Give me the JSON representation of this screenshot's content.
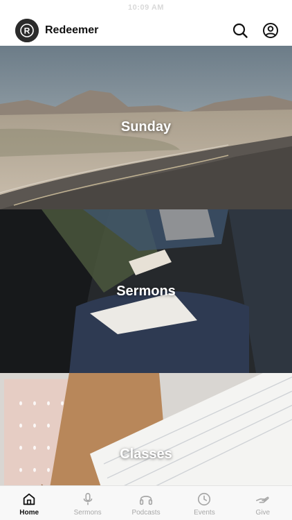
{
  "status_bar": {
    "time": "10:09 AM"
  },
  "header": {
    "app_name": "Redeemer",
    "logo_letter": "R"
  },
  "cards": [
    {
      "title": "Sunday"
    },
    {
      "title": "Sermons"
    },
    {
      "title": "Classes"
    }
  ],
  "tabs": [
    {
      "label": "Home",
      "icon": "home-icon",
      "active": true
    },
    {
      "label": "Sermons",
      "icon": "microphone-icon",
      "active": false
    },
    {
      "label": "Podcasts",
      "icon": "headphones-icon",
      "active": false
    },
    {
      "label": "Events",
      "icon": "clock-icon",
      "active": false
    },
    {
      "label": "Give",
      "icon": "giving-hand-icon",
      "active": false
    }
  ],
  "colors": {
    "active_tab": "#111111",
    "inactive_tab": "#a7a7a7",
    "logo_bg": "#2b2b2b"
  }
}
